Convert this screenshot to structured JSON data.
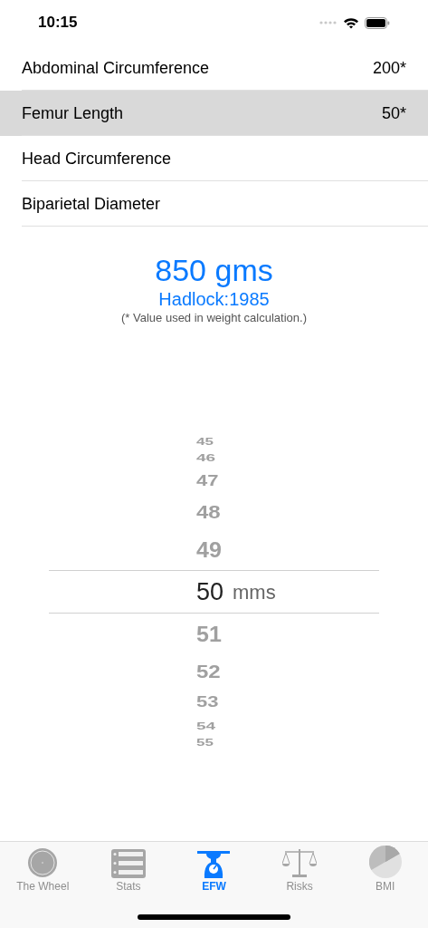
{
  "status_bar": {
    "time": "10:15"
  },
  "measurements": [
    {
      "label": "Abdominal Circumference",
      "value": "200*",
      "selected": false
    },
    {
      "label": "Femur Length",
      "value": "50*",
      "selected": true
    },
    {
      "label": "Head Circumference",
      "selected": false
    },
    {
      "label": "Biparietal Diameter",
      "selected": false
    }
  ],
  "result": {
    "weight": "850 gms",
    "formula": "Hadlock:1985",
    "note": "(* Value used in weight calculation.)"
  },
  "picker": {
    "unit": "mms",
    "items": [
      {
        "label": "45",
        "selected": false
      },
      {
        "label": "46",
        "selected": false
      },
      {
        "label": "47",
        "selected": false
      },
      {
        "label": "48",
        "selected": false
      },
      {
        "label": "49",
        "selected": false
      },
      {
        "label": "50",
        "selected": true
      },
      {
        "label": "51",
        "selected": false
      },
      {
        "label": "52",
        "selected": false
      },
      {
        "label": "53",
        "selected": false
      },
      {
        "label": "54",
        "selected": false
      },
      {
        "label": "55",
        "selected": false
      }
    ]
  },
  "tab_bar": [
    {
      "label": "The Wheel",
      "selected": false
    },
    {
      "label": "Stats",
      "selected": false
    },
    {
      "label": "EFW",
      "selected": true
    },
    {
      "label": "Risks",
      "selected": false
    },
    {
      "label": "BMI",
      "selected": false
    }
  ]
}
